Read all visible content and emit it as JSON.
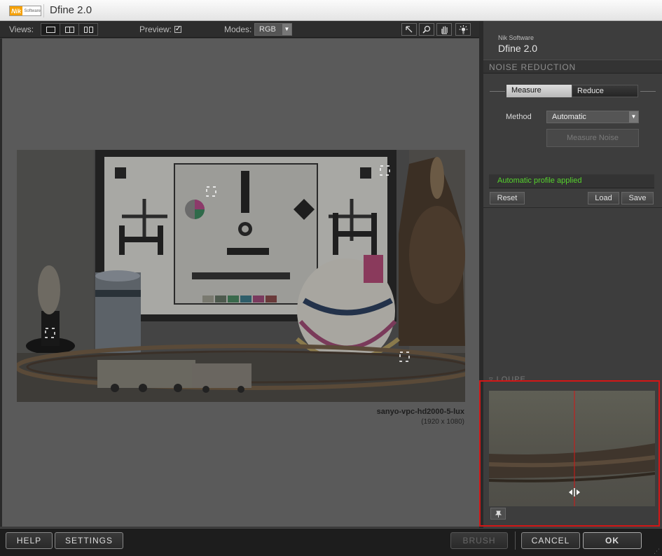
{
  "window": {
    "logo_text": "Nik",
    "logo_subtext": "Software",
    "title": "Dfine 2.0"
  },
  "toolbar": {
    "views_label": "Views:",
    "preview_label": "Preview:",
    "preview_checked": true,
    "modes_label": "Modes:",
    "mode_value": "RGB",
    "tools": [
      "pointer-tool-icon",
      "zoom-tool-icon",
      "hand-tool-icon",
      "light-tool-icon"
    ]
  },
  "image": {
    "filename": "sanyo-vpc-hd2000-5-lux",
    "dimensions": "(1920 x 1080)"
  },
  "panel": {
    "vendor": "Nik Software",
    "product": "Dfine 2.0",
    "section_title": "NOISE REDUCTION",
    "tabs": [
      "Measure",
      "Reduce"
    ],
    "method_label": "Method",
    "method_value": "Automatic",
    "measure_noise_label": "Measure Noise",
    "status_text": "Automatic profile applied",
    "reset_label": "Reset",
    "load_label": "Load",
    "save_label": "Save",
    "loupe_title": "LOUPE"
  },
  "bottom": {
    "help_label": "HELP",
    "settings_label": "SETTINGS",
    "brush_label": "BRUSH",
    "cancel_label": "CANCEL",
    "ok_label": "OK"
  },
  "colors": {
    "status_green": "#56d22d",
    "highlight_red": "#d41616"
  }
}
